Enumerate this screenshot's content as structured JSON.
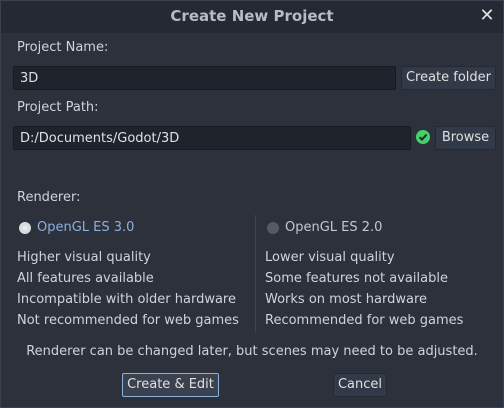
{
  "dialog": {
    "title": "Create New Project",
    "close_icon": "close-icon"
  },
  "project_name": {
    "label": "Project Name:",
    "value": "3D",
    "create_folder_label": "Create folder"
  },
  "project_path": {
    "label": "Project Path:",
    "value": "D:/Documents/Godot/3D",
    "status_icon": "check-circle-icon",
    "status_color": "#45d06a",
    "browse_label": "Browse"
  },
  "renderer": {
    "label": "Renderer:",
    "options": [
      {
        "label": "OpenGL ES 3.0",
        "selected": true,
        "features": [
          "Higher visual quality",
          "All features available",
          "Incompatible with older hardware",
          "Not recommended for web games"
        ]
      },
      {
        "label": "OpenGL ES 2.0",
        "selected": false,
        "features": [
          "Lower visual quality",
          "Some features not available",
          "Works on most hardware",
          "Recommended for web games"
        ]
      }
    ],
    "note": "Renderer can be changed later, but scenes may need to be adjusted."
  },
  "actions": {
    "create_edit_label": "Create & Edit",
    "cancel_label": "Cancel"
  },
  "colors": {
    "accent": "#8db0df",
    "background": "#2c313c",
    "titlebar": "#242933"
  }
}
